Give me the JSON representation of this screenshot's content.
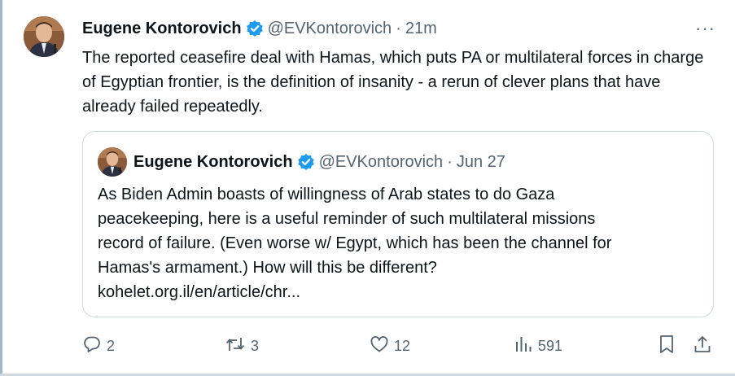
{
  "tweet": {
    "author_name": "Eugene Kontorovich",
    "handle": "@EVKontorovich",
    "separator": "·",
    "time": "21m",
    "more_label": "···",
    "text": "The reported ceasefire deal with Hamas, which puts PA or multilateral forces in charge of Egyptian frontier, is the definition of insanity - a rerun of clever plans that have already failed repeatedly."
  },
  "quote": {
    "author_name": "Eugene Kontorovich",
    "handle": "@EVKontorovich",
    "separator": "·",
    "time": "Jun 27",
    "text_lines": [
      "As Biden Admin boasts of willingness of Arab states to do Gaza",
      "peacekeeping, here is a useful reminder of such multilateral missions",
      "record of failure. (Even worse w/ Egypt, which has been the channel for",
      "Hamas's armament.) How will this be different?",
      "kohelet.org.il/en/article/chr..."
    ]
  },
  "actions": {
    "replies": "2",
    "reposts": "3",
    "likes": "12",
    "views": "591"
  },
  "colors": {
    "verified_badge": "#1d9bf0",
    "text_primary": "#0f1419",
    "text_secondary": "#536471",
    "border": "#cfd9de"
  },
  "icons": [
    "reply-icon",
    "repost-icon",
    "like-icon",
    "views-icon",
    "bookmark-icon",
    "share-icon",
    "verified-icon",
    "more-icon"
  ]
}
